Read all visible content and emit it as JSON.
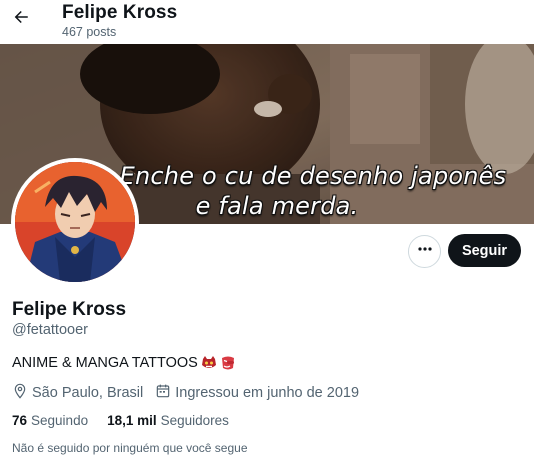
{
  "header": {
    "title": "Felipe Kross",
    "posts_count": "467 posts",
    "back_icon": "arrow-left-icon"
  },
  "banner": {
    "caption_line1": "Enche o cu de desenho japonês",
    "caption_line2": "e fala merda."
  },
  "profile": {
    "display_name": "Felipe Kross",
    "handle": "@fetattooer",
    "bio": "ANIME & MANGA TATTOOS",
    "bio_emojis": [
      "oni-mask-emoji",
      "japanese-goblin-emoji"
    ],
    "location": "São Paulo, Brasil",
    "joined": "Ingressou em junho de 2019",
    "following_count": "76",
    "following_label": "Seguindo",
    "followers_count": "18,1 mil",
    "followers_label": "Seguidores",
    "not_followed_text": "Não é seguido por ninguém que você segue"
  },
  "actions": {
    "more_icon": "more-horizontal-icon",
    "follow_label": "Seguir"
  },
  "colors": {
    "text_primary": "#0f1419",
    "text_secondary": "#536471",
    "button_dark": "#0f1419",
    "border": "#cfd9de"
  }
}
